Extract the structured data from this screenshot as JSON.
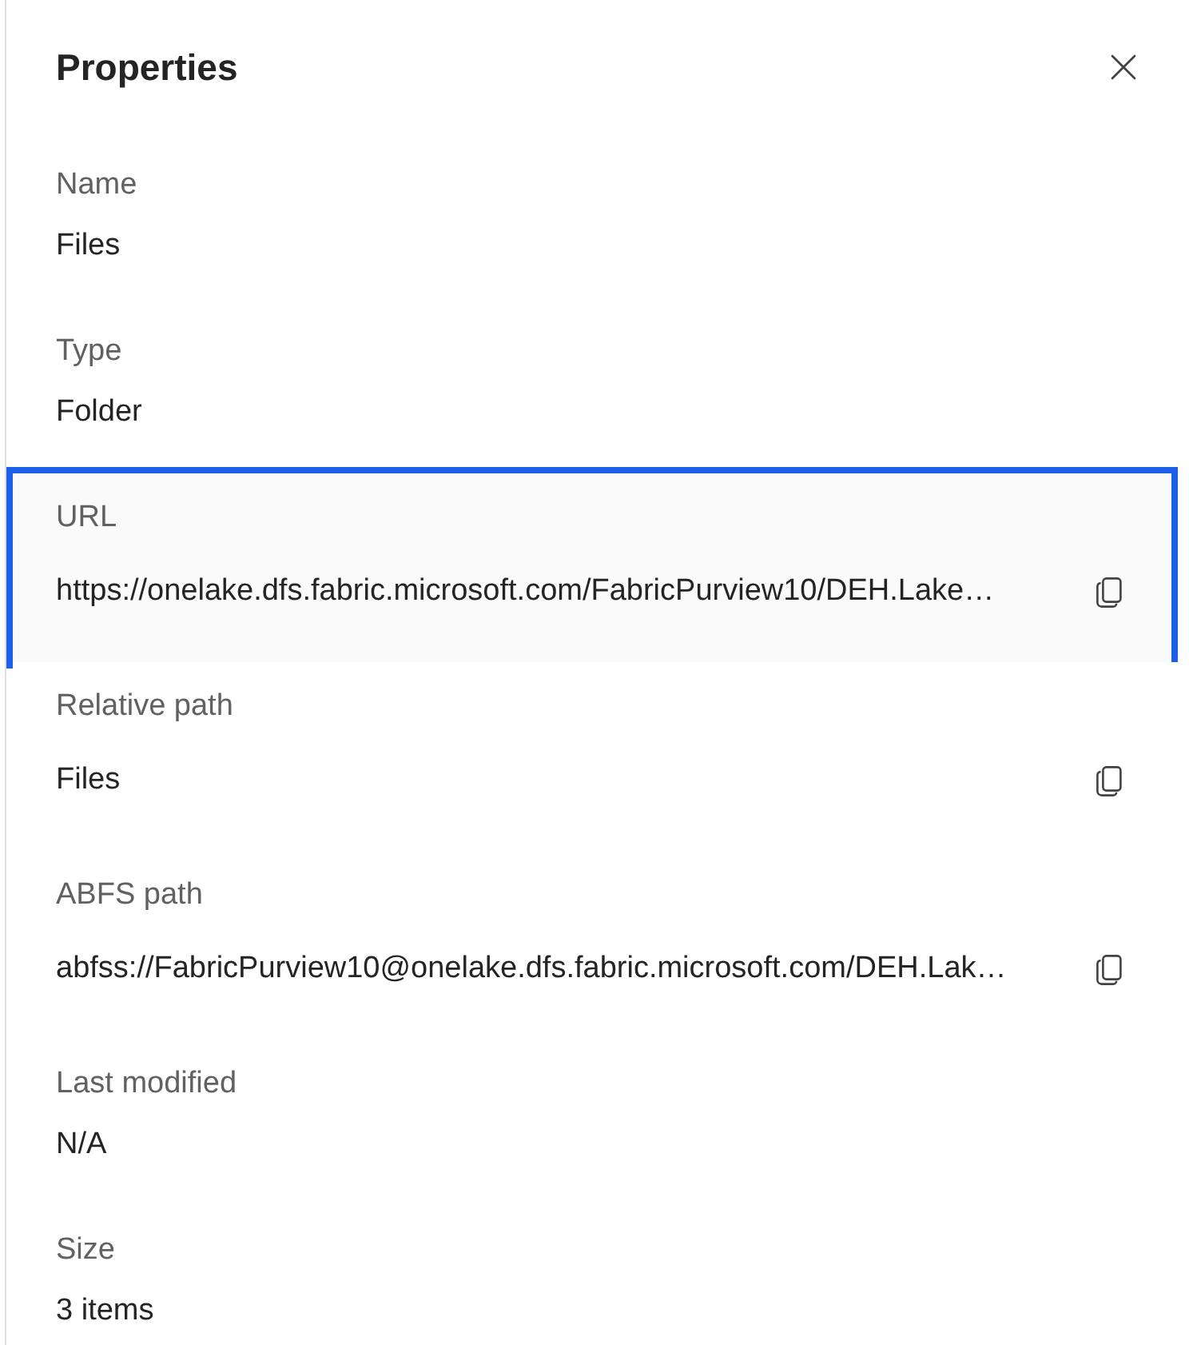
{
  "panel": {
    "title": "Properties"
  },
  "fields": [
    {
      "kind": "text",
      "label": "Name",
      "value": "Files",
      "highlighted": false
    },
    {
      "kind": "text",
      "label": "Type",
      "value": "Folder",
      "highlighted": false
    },
    {
      "kind": "copy",
      "label": "URL",
      "value": "https://onelake.dfs.fabric.microsoft.com/FabricPurview10/DEH.Lake…",
      "highlighted": true
    },
    {
      "kind": "copy",
      "label": "Relative path",
      "value": "Files",
      "highlighted": false
    },
    {
      "kind": "copy",
      "label": "ABFS path",
      "value": "abfss://FabricPurview10@onelake.dfs.fabric.microsoft.com/DEH.Lak…",
      "highlighted": false
    },
    {
      "kind": "text",
      "label": "Last modified",
      "value": "N/A",
      "highlighted": false
    },
    {
      "kind": "text",
      "label": "Size",
      "value": "3 items",
      "highlighted": false
    }
  ]
}
